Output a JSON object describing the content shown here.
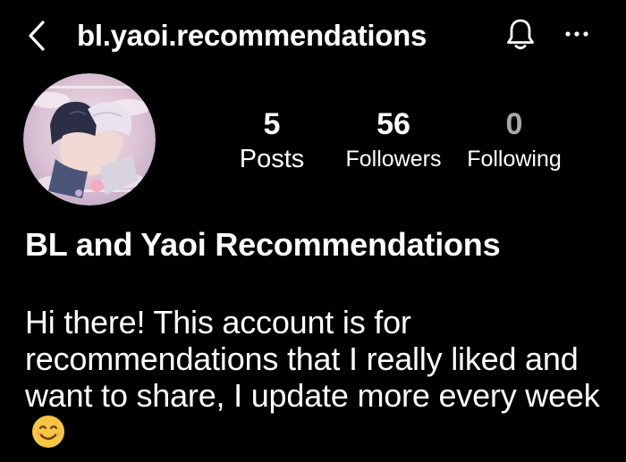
{
  "header": {
    "username": "bl.yaoi.recommendations",
    "back_icon": "chevron-left-icon",
    "bell_icon": "bell-icon",
    "more_icon": "more-horizontal-icon"
  },
  "profile": {
    "avatar_icon": "profile-avatar-illustration",
    "stats": {
      "posts": {
        "value": "5",
        "label": "Posts"
      },
      "followers": {
        "value": "56",
        "label": "Followers"
      },
      "following": {
        "value": "0",
        "label": "Following"
      }
    },
    "display_name": "BL and Yaoi Recommendations",
    "bio": "Hi there! This account is for recommendations that I really liked and want to share, I update more every week",
    "bio_emoji": "smiling-face-icon"
  },
  "colors": {
    "background": "#000000",
    "text": "#ffffff",
    "following_value": "#a8a8a8",
    "emoji_face": "#f6c542",
    "avatar_pink": "#e8c8d6",
    "avatar_purple": "#b8a9cf"
  }
}
